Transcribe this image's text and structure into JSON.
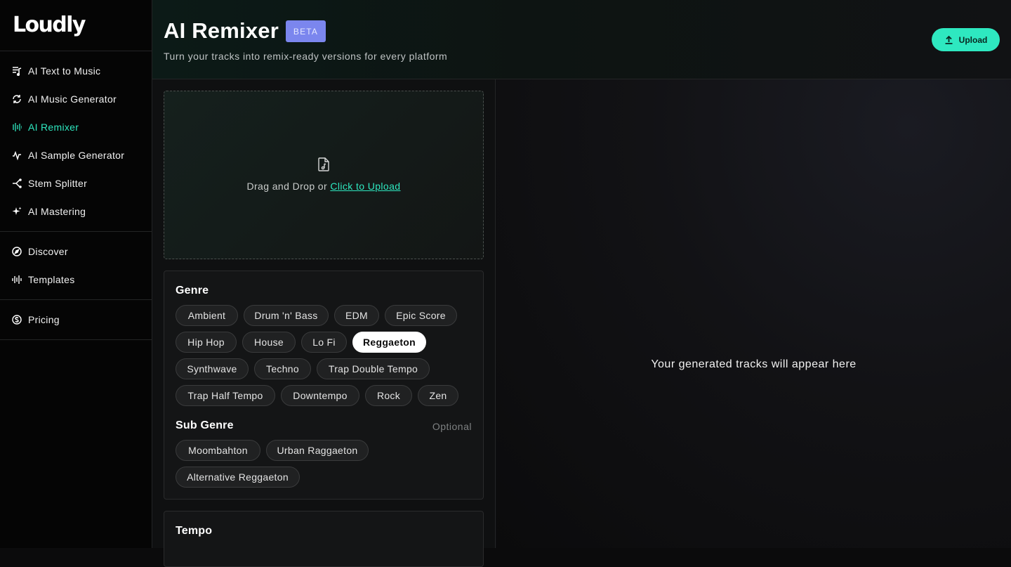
{
  "app": {
    "logo": "Loudly"
  },
  "sidebar": {
    "groups": [
      [
        {
          "label": "AI Text to Music",
          "icon": "text-music-icon"
        },
        {
          "label": "AI Music Generator",
          "icon": "generator-icon"
        },
        {
          "label": "AI Remixer",
          "icon": "remixer-icon",
          "active": true
        },
        {
          "label": "AI Sample Generator",
          "icon": "sample-icon"
        },
        {
          "label": "Stem Splitter",
          "icon": "split-icon"
        },
        {
          "label": "AI Mastering",
          "icon": "sparkle-icon"
        }
      ],
      [
        {
          "label": "Discover",
          "icon": "compass-icon"
        },
        {
          "label": "Templates",
          "icon": "waveform-icon"
        }
      ],
      [
        {
          "label": "Pricing",
          "icon": "dollar-icon"
        }
      ]
    ]
  },
  "header": {
    "title": "AI Remixer",
    "badge": "BETA",
    "subtitle": "Turn your tracks into remix-ready versions for every platform",
    "upload_label": "Upload"
  },
  "dropzone": {
    "text": "Drag and Drop or ",
    "link": "Click to Upload"
  },
  "genre": {
    "title": "Genre",
    "selected": "Reggaeton",
    "options": [
      "Ambient",
      "Drum 'n' Bass",
      "EDM",
      "Epic Score",
      "Hip Hop",
      "House",
      "Lo Fi",
      "Reggaeton",
      "Synthwave",
      "Techno",
      "Trap Double Tempo",
      "Trap Half Tempo",
      "Downtempo",
      "Rock",
      "Zen"
    ]
  },
  "sub_genre": {
    "title": "Sub Genre",
    "optional_label": "Optional",
    "options": [
      "Moombahton",
      "Urban Raggaeton",
      "Alternative Reggaeton"
    ]
  },
  "tempo": {
    "title": "Tempo"
  },
  "output": {
    "placeholder": "Your generated tracks will appear here"
  },
  "colors": {
    "accent": "#2ee8c0",
    "beta": "#7b86ee",
    "background": "#0b0b0c"
  }
}
